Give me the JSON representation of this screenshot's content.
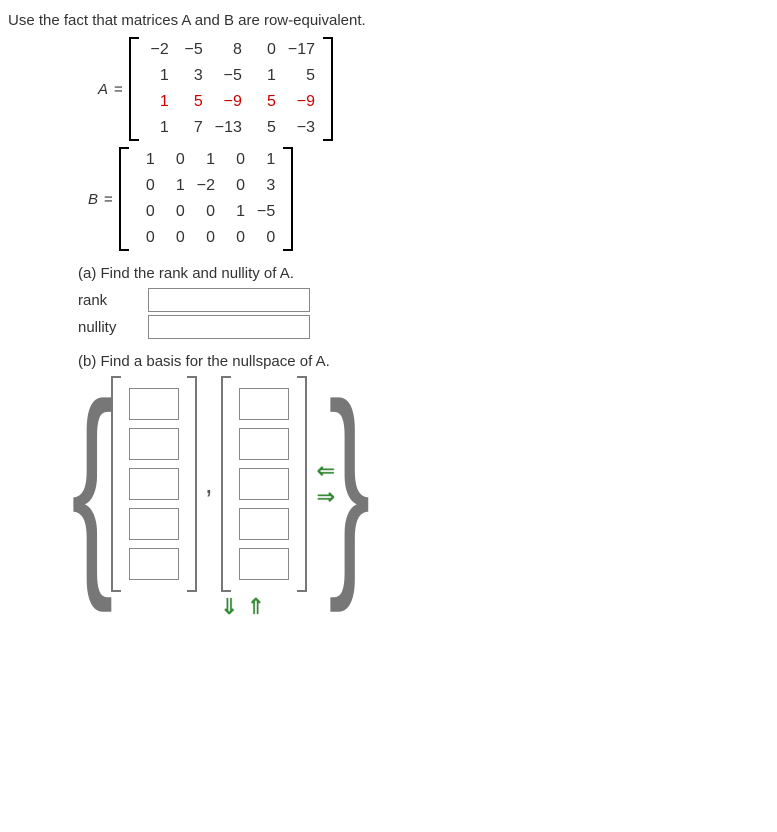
{
  "prompt": "Use the fact that matrices A and B are row-equivalent.",
  "matrices": {
    "A": {
      "name": "A",
      "eq": "=",
      "rows": [
        [
          "−2",
          "−5",
          "8",
          "0",
          "−17"
        ],
        [
          "1",
          "3",
          "−5",
          "1",
          "5"
        ],
        [
          "1",
          "5",
          "−9",
          "5",
          "−9"
        ],
        [
          "1",
          "7",
          "−13",
          "5",
          "−3"
        ]
      ],
      "highlight_row_index": 2
    },
    "B": {
      "name": "B",
      "eq": "=",
      "rows": [
        [
          "1",
          "0",
          "1",
          "0",
          "1"
        ],
        [
          "0",
          "1",
          "−2",
          "0",
          "3"
        ],
        [
          "0",
          "0",
          "0",
          "1",
          "−5"
        ],
        [
          "0",
          "0",
          "0",
          "0",
          "0"
        ]
      ]
    }
  },
  "parts": {
    "a": {
      "text": "(a) Find the rank and nullity of A.",
      "rank_label": "rank",
      "nullity_label": "nullity",
      "rank_value": "",
      "nullity_value": ""
    },
    "b": {
      "text": "(b) Find a basis for the nullspace of A.",
      "vector_count": 2,
      "vector_size": 5,
      "comma": ","
    }
  },
  "arrows": {
    "left": "⇐",
    "right": "⇒",
    "down": "⇓",
    "up": "⇑"
  }
}
